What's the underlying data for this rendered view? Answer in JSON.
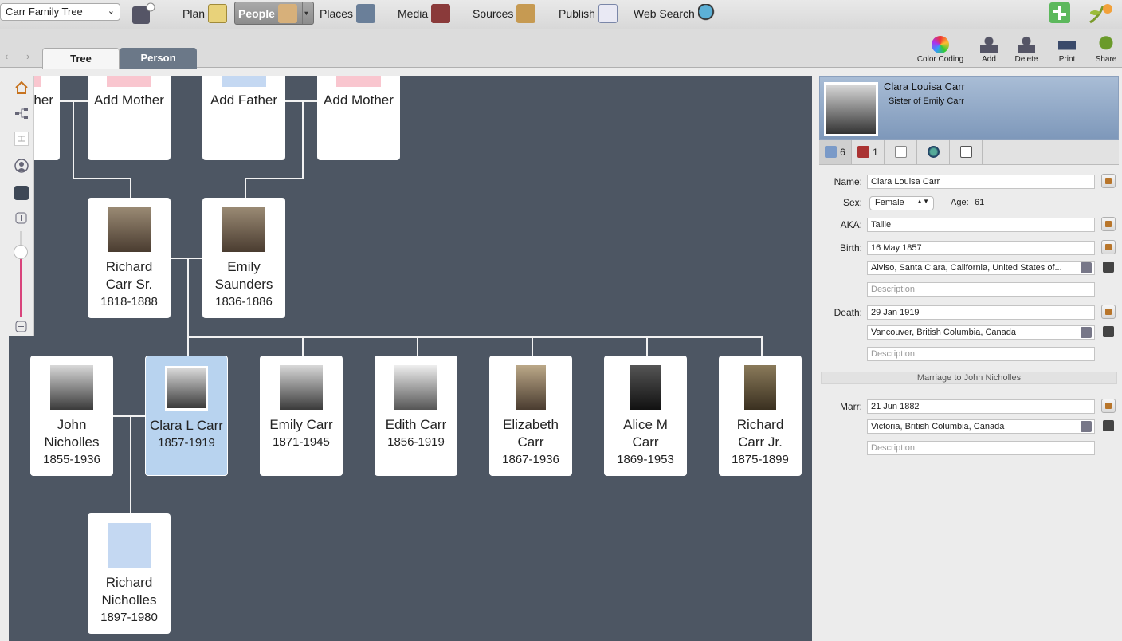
{
  "toolbar": {
    "tree_name": "Carr Family Tree",
    "nav": [
      {
        "label": "Plan",
        "icon": "plan-icon"
      },
      {
        "label": "People",
        "icon": "people-icon"
      },
      {
        "label": "Places",
        "icon": "places-icon"
      },
      {
        "label": "Media",
        "icon": "media-icon"
      },
      {
        "label": "Sources",
        "icon": "sources-icon"
      },
      {
        "label": "Publish",
        "icon": "publish-icon"
      },
      {
        "label": "Web Search",
        "icon": "web-search-icon"
      }
    ],
    "active_nav": "People"
  },
  "view": {
    "tabs": [
      "Tree",
      "Person"
    ],
    "active_tab": "Tree",
    "tools": [
      {
        "label": "Color Coding",
        "icon": "color-wheel-icon"
      },
      {
        "label": "Add",
        "icon": "add-person-icon"
      },
      {
        "label": "Delete",
        "icon": "delete-person-icon"
      },
      {
        "label": "Print",
        "icon": "printer-icon"
      },
      {
        "label": "Share",
        "icon": "share-icon"
      }
    ]
  },
  "tree": {
    "stubs": [
      {
        "label": "ther"
      },
      {
        "label": "Add Mother"
      },
      {
        "label": "Add Father"
      },
      {
        "label": "Add Mother"
      }
    ],
    "parents": [
      {
        "name_line1": "Richard",
        "name_line2": "Carr Sr.",
        "dates": "1818-1888"
      },
      {
        "name_line1": "Emily",
        "name_line2": "Saunders",
        "dates": "1836-1886"
      }
    ],
    "children": [
      {
        "name_line1": "John",
        "name_line2": "Nicholles",
        "dates": "1855-1936"
      },
      {
        "name_line1": "Clara L Carr",
        "name_line2": "",
        "dates": "1857-1919"
      },
      {
        "name_line1": "Emily Carr",
        "name_line2": "",
        "dates": "1871-1945"
      },
      {
        "name_line1": "Edith Carr",
        "name_line2": "",
        "dates": "1856-1919"
      },
      {
        "name_line1": "Elizabeth",
        "name_line2": "Carr",
        "dates": "1867-1936"
      },
      {
        "name_line1": "Alice M",
        "name_line2": "Carr",
        "dates": "1869-1953"
      },
      {
        "name_line1": "Richard",
        "name_line2": "Carr Jr.",
        "dates": "1875-1899"
      }
    ],
    "grandchildren": [
      {
        "name_line1": "Richard",
        "name_line2": "Nicholles",
        "dates": "1897-1980"
      }
    ],
    "selected": "Clara L Carr"
  },
  "person": {
    "name": "Clara Louisa Carr",
    "relation": "Sister of Emily Carr",
    "tab_counts": {
      "facts": "6",
      "sources": "1"
    },
    "labels": {
      "name": "Name:",
      "sex": "Sex:",
      "age": "Age:",
      "aka": "AKA:",
      "birth": "Birth:",
      "death": "Death:",
      "marr": "Marr:"
    },
    "name_value": "Clara Louisa Carr",
    "sex": "Female",
    "age": "61",
    "aka": "Tallie",
    "birth_date": "16 May 1857",
    "birth_place": "Alviso, Santa Clara, California, United States of...",
    "death_date": "29 Jan 1919",
    "death_place": "Vancouver, British Columbia, Canada",
    "description_placeholder": "Description",
    "marriage_header": "Marriage to John Nicholles",
    "marr_date": "21 Jun 1882",
    "marr_place": "Victoria, British Columbia, Canada"
  }
}
